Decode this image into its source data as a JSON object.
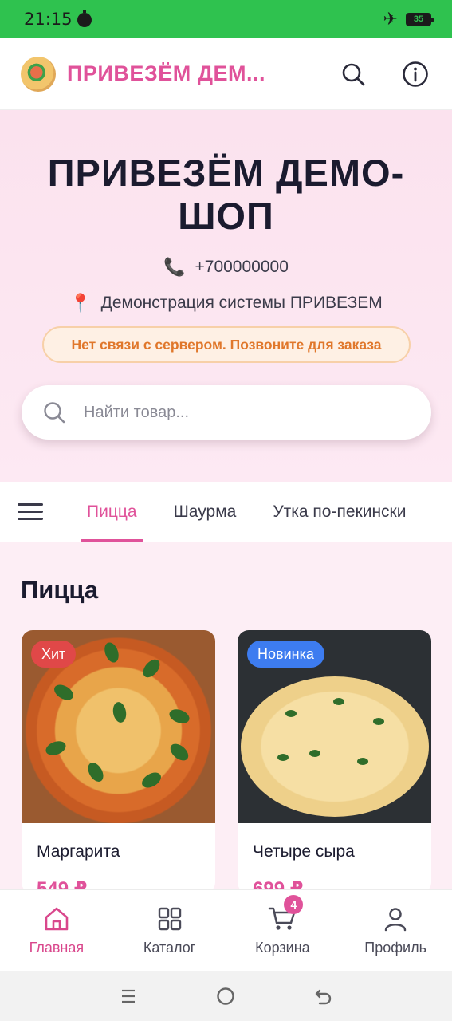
{
  "status_bar": {
    "time": "21:15",
    "battery": "35"
  },
  "header": {
    "app_title": "ПРИВЕЗЁМ ДЕМ...",
    "icons": [
      "search-icon",
      "info-icon"
    ]
  },
  "hero": {
    "shop_name": "ПРИВЕЗЁМ ДЕМО-ШОП",
    "phone_emoji": "📞",
    "phone": "+700000000",
    "address_emoji": "📍",
    "address": "Демонстрация системы ПРИВЕЗЕМ",
    "alert": "Нет связи с сервером. Позвоните для заказа",
    "search_placeholder": "Найти товар..."
  },
  "tabs": [
    {
      "label": "Пицца",
      "active": true
    },
    {
      "label": "Шаурма",
      "active": false
    },
    {
      "label": "Утка по-пекински",
      "active": false
    }
  ],
  "section": {
    "title": "Пицца"
  },
  "products": [
    {
      "name": "Маргарита",
      "price": "549 ₽",
      "badge": "Хит"
    },
    {
      "name": "Четыре сыра",
      "price": "699 ₽",
      "badge": "Новинка"
    }
  ],
  "bottom_nav": [
    {
      "label": "Главная",
      "icon": "home-icon",
      "active": true
    },
    {
      "label": "Каталог",
      "icon": "grid-icon",
      "active": false
    },
    {
      "label": "Корзина",
      "icon": "cart-icon",
      "active": false,
      "badge": "4"
    },
    {
      "label": "Профиль",
      "icon": "user-icon",
      "active": false
    }
  ],
  "colors": {
    "accent": "#e0529a",
    "status_bar": "#2fc24f",
    "alert_text": "#e0772b",
    "badge_hit": "#e04848",
    "badge_new": "#3d7cf0"
  }
}
